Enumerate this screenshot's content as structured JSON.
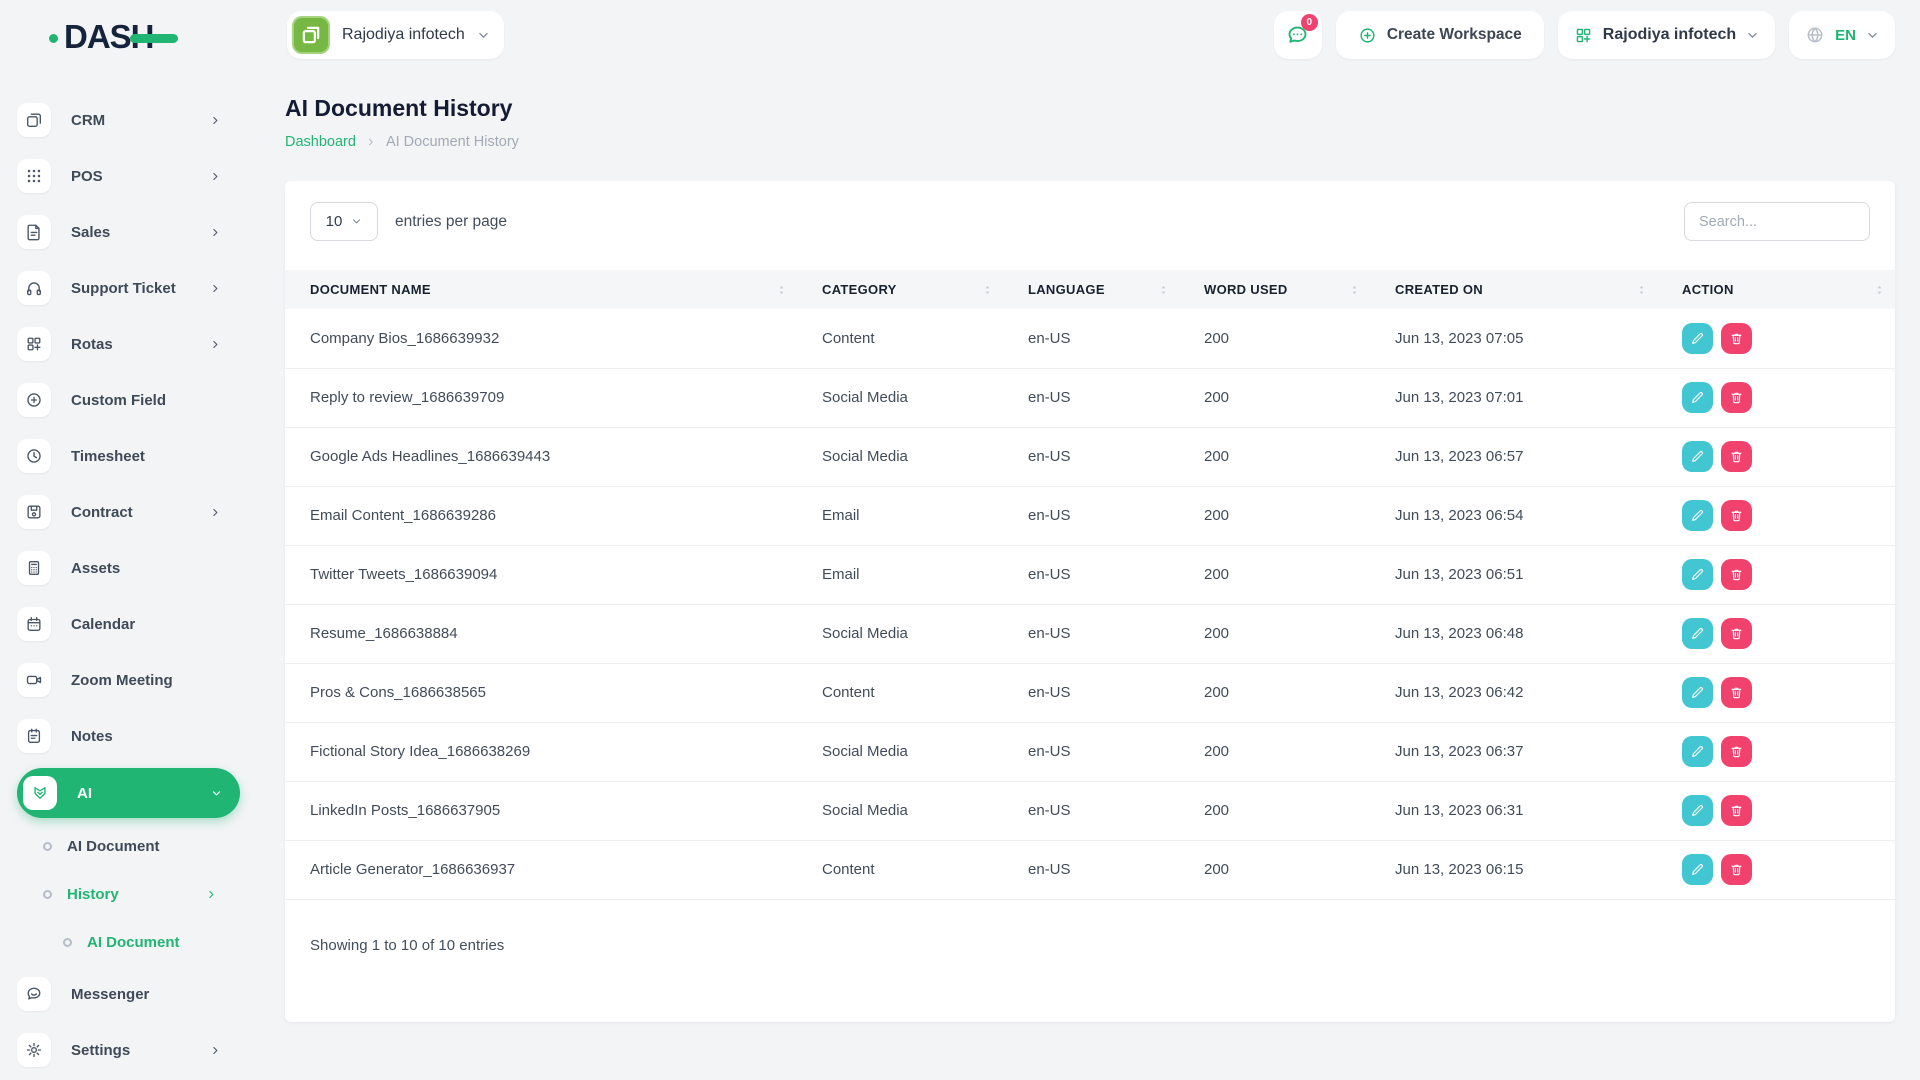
{
  "theme": {
    "accent_green": "#21b573",
    "edit_cyan": "#41c6d2",
    "delete_pink": "#f1426e",
    "avatar_green": "#76b843",
    "navy": "#15233c"
  },
  "header": {
    "logo_text": "DASH",
    "workspace_switcher": {
      "label": "Rajodiya infotech"
    },
    "chat": {
      "badge": "0"
    },
    "create_workspace_label": "Create Workspace",
    "account_menu": {
      "label": "Rajodiya infotech"
    },
    "language_menu": {
      "label": "EN"
    }
  },
  "sidebar": {
    "items": [
      {
        "label": "CRM",
        "icon": "crm-icon",
        "chevron": "right"
      },
      {
        "label": "POS",
        "icon": "pos-icon",
        "chevron": "right"
      },
      {
        "label": "Sales",
        "icon": "sales-icon",
        "chevron": "right"
      },
      {
        "label": "Support Ticket",
        "icon": "support-ticket-icon",
        "chevron": "right"
      },
      {
        "label": "Rotas",
        "icon": "rotas-icon",
        "chevron": "right"
      },
      {
        "label": "Custom Field",
        "icon": "custom-field-icon",
        "chevron": ""
      },
      {
        "label": "Timesheet",
        "icon": "timesheet-icon",
        "chevron": ""
      },
      {
        "label": "Contract",
        "icon": "contract-icon",
        "chevron": "right"
      },
      {
        "label": "Assets",
        "icon": "assets-icon",
        "chevron": ""
      },
      {
        "label": "Calendar",
        "icon": "calendar-icon",
        "chevron": ""
      },
      {
        "label": "Zoom Meeting",
        "icon": "zoom-meeting-icon",
        "chevron": ""
      },
      {
        "label": "Notes",
        "icon": "notes-icon",
        "chevron": ""
      },
      {
        "label": "AI",
        "icon": "ai-icon",
        "chevron": "down",
        "type": "pill",
        "active": true
      },
      {
        "label": "AI Document",
        "type": "sub",
        "level": 1
      },
      {
        "label": "History",
        "type": "sub",
        "level": 1,
        "active": true,
        "chevron": "right"
      },
      {
        "label": "AI Document",
        "type": "sub",
        "level": 2,
        "active": true
      },
      {
        "label": "Messenger",
        "icon": "messenger-icon",
        "chevron": ""
      },
      {
        "label": "Settings",
        "icon": "settings-icon",
        "chevron": "right"
      }
    ]
  },
  "page": {
    "title": "AI Document History",
    "breadcrumb": [
      "Dashboard",
      "AI Document History"
    ]
  },
  "table_card": {
    "entries_per_page": {
      "value": "10",
      "label": "entries per page"
    },
    "search_placeholder": "Search...",
    "columns": [
      "DOCUMENT NAME",
      "CATEGORY",
      "LANGUAGE",
      "WORD USED",
      "CREATED ON",
      "ACTION"
    ],
    "rows": [
      {
        "name": "Company Bios_1686639932",
        "category": "Content",
        "language": "en-US",
        "words": "200",
        "created": "Jun 13, 2023 07:05"
      },
      {
        "name": "Reply to review_1686639709",
        "category": "Social Media",
        "language": "en-US",
        "words": "200",
        "created": "Jun 13, 2023 07:01"
      },
      {
        "name": "Google Ads Headlines_1686639443",
        "category": "Social Media",
        "language": "en-US",
        "words": "200",
        "created": "Jun 13, 2023 06:57"
      },
      {
        "name": "Email Content_1686639286",
        "category": "Email",
        "language": "en-US",
        "words": "200",
        "created": "Jun 13, 2023 06:54"
      },
      {
        "name": "Twitter Tweets_1686639094",
        "category": "Email",
        "language": "en-US",
        "words": "200",
        "created": "Jun 13, 2023 06:51"
      },
      {
        "name": "Resume_1686638884",
        "category": "Social Media",
        "language": "en-US",
        "words": "200",
        "created": "Jun 13, 2023 06:48"
      },
      {
        "name": "Pros & Cons_1686638565",
        "category": "Content",
        "language": "en-US",
        "words": "200",
        "created": "Jun 13, 2023 06:42"
      },
      {
        "name": "Fictional Story Idea_1686638269",
        "category": "Social Media",
        "language": "en-US",
        "words": "200",
        "created": "Jun 13, 2023 06:37"
      },
      {
        "name": "LinkedIn Posts_1686637905",
        "category": "Social Media",
        "language": "en-US",
        "words": "200",
        "created": "Jun 13, 2023 06:31"
      },
      {
        "name": "Article Generator_1686636937",
        "category": "Content",
        "language": "en-US",
        "words": "200",
        "created": "Jun 13, 2023 06:15"
      }
    ],
    "footer": "Showing 1 to 10 of 10 entries"
  }
}
